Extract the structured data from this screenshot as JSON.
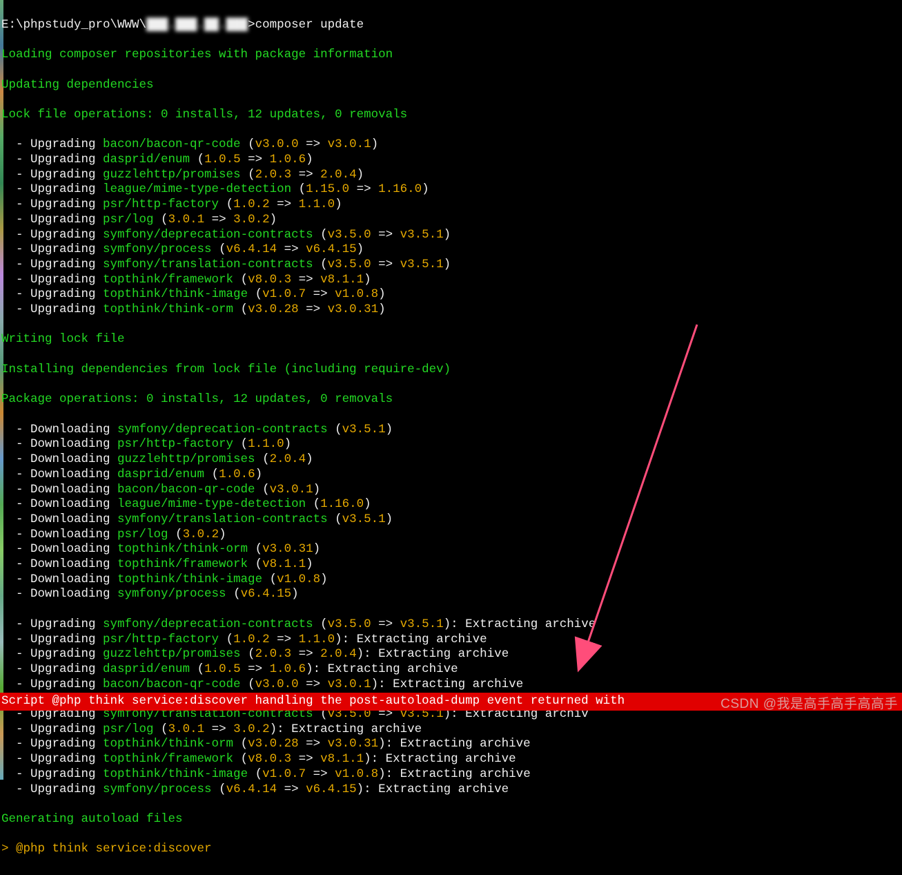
{
  "prompt": {
    "cwd_prefix": "E:\\phpstudy_pro\\WWW\\",
    "cwd_blurred": "███.███.██.███",
    "cmd": ">composer update"
  },
  "headers": {
    "loading": "Loading composer repositories with package information",
    "updating": "Updating dependencies",
    "lock_ops": "Lock file operations: 0 installs, 12 updates, 0 removals",
    "writing": "Writing lock file",
    "installing": "Installing dependencies from lock file (including require-dev)",
    "pkg_ops": "Package operations: 0 installs, 12 updates, 0 removals",
    "autoload": "Generating autoload files",
    "service": "> @php think service:discover"
  },
  "upgrades1": [
    {
      "pkg": "bacon/bacon-qr-code",
      "from": "v3.0.0",
      "to": "v3.0.1"
    },
    {
      "pkg": "dasprid/enum",
      "from": "1.0.5",
      "to": "1.0.6"
    },
    {
      "pkg": "guzzlehttp/promises",
      "from": "2.0.3",
      "to": "2.0.4"
    },
    {
      "pkg": "league/mime-type-detection",
      "from": "1.15.0",
      "to": "1.16.0"
    },
    {
      "pkg": "psr/http-factory",
      "from": "1.0.2",
      "to": "1.1.0"
    },
    {
      "pkg": "psr/log",
      "from": "3.0.1",
      "to": "3.0.2"
    },
    {
      "pkg": "symfony/deprecation-contracts",
      "from": "v3.5.0",
      "to": "v3.5.1"
    },
    {
      "pkg": "symfony/process",
      "from": "v6.4.14",
      "to": "v6.4.15"
    },
    {
      "pkg": "symfony/translation-contracts",
      "from": "v3.5.0",
      "to": "v3.5.1"
    },
    {
      "pkg": "topthink/framework",
      "from": "v8.0.3",
      "to": "v8.1.1"
    },
    {
      "pkg": "topthink/think-image",
      "from": "v1.0.7",
      "to": "v1.0.8"
    },
    {
      "pkg": "topthink/think-orm",
      "from": "v3.0.28",
      "to": "v3.0.31"
    }
  ],
  "downloads": [
    {
      "pkg": "symfony/deprecation-contracts",
      "ver": "v3.5.1"
    },
    {
      "pkg": "psr/http-factory",
      "ver": "1.1.0"
    },
    {
      "pkg": "guzzlehttp/promises",
      "ver": "2.0.4"
    },
    {
      "pkg": "dasprid/enum",
      "ver": "1.0.6"
    },
    {
      "pkg": "bacon/bacon-qr-code",
      "ver": "v3.0.1"
    },
    {
      "pkg": "league/mime-type-detection",
      "ver": "1.16.0"
    },
    {
      "pkg": "symfony/translation-contracts",
      "ver": "v3.5.1"
    },
    {
      "pkg": "psr/log",
      "ver": "3.0.2"
    },
    {
      "pkg": "topthink/think-orm",
      "ver": "v3.0.31"
    },
    {
      "pkg": "topthink/framework",
      "ver": "v8.1.1"
    },
    {
      "pkg": "topthink/think-image",
      "ver": "v1.0.8"
    },
    {
      "pkg": "symfony/process",
      "ver": "v6.4.15"
    }
  ],
  "upgrades2": [
    {
      "pkg": "symfony/deprecation-contracts",
      "from": "v3.5.0",
      "to": "v3.5.1",
      "tail": ": Extracting archive"
    },
    {
      "pkg": "psr/http-factory",
      "from": "1.0.2",
      "to": "1.1.0",
      "tail": ": Extracting archive"
    },
    {
      "pkg": "guzzlehttp/promises",
      "from": "2.0.3",
      "to": "2.0.4",
      "tail": ": Extracting archive"
    },
    {
      "pkg": "dasprid/enum",
      "from": "1.0.5",
      "to": "1.0.6",
      "tail": ": Extracting archive"
    },
    {
      "pkg": "bacon/bacon-qr-code",
      "from": "v3.0.0",
      "to": "v3.0.1",
      "tail": ": Extracting archive"
    },
    {
      "pkg": "league/mime-type-detection",
      "from": "1.15.0",
      "to": "1.16.0",
      "tail": ": Extracting archive"
    },
    {
      "pkg": "symfony/translation-contracts",
      "from": "v3.5.0",
      "to": "v3.5.1",
      "tail": ": Extracting archiv"
    },
    {
      "pkg": "psr/log",
      "from": "3.0.1",
      "to": "3.0.2",
      "tail": ": Extracting archive"
    },
    {
      "pkg": "topthink/think-orm",
      "from": "v3.0.28",
      "to": "v3.0.31",
      "tail": ": Extracting archive"
    },
    {
      "pkg": "topthink/framework",
      "from": "v8.0.3",
      "to": "v8.1.1",
      "tail": ": Extracting archive"
    },
    {
      "pkg": "topthink/think-image",
      "from": "v1.0.7",
      "to": "v1.0.8",
      "tail": ": Extracting archive"
    },
    {
      "pkg": "symfony/process",
      "from": "v6.4.14",
      "to": "v6.4.15",
      "tail": ": Extracting archive"
    }
  ],
  "labels": {
    "upgrading": "Upgrading",
    "downloading": "Downloading",
    "arrow": " => "
  },
  "error": "Script @php think service:discover handling the post-autoload-dump event returned with ",
  "watermark": "CSDN @我是高手高手高高手"
}
